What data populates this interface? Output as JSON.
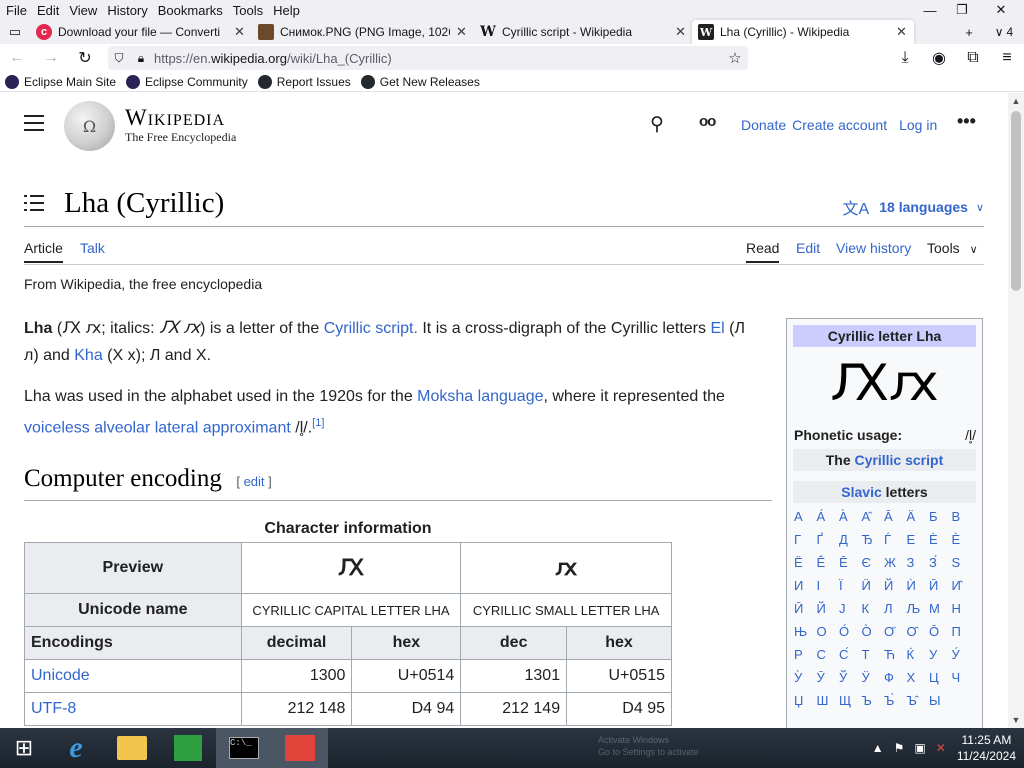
{
  "menubar": {
    "items": [
      "File",
      "Edit",
      "View",
      "History",
      "Bookmarks",
      "Tools",
      "Help"
    ]
  },
  "tabs": [
    {
      "title": "Download your file — Converti",
      "icon": "converter-icon"
    },
    {
      "title": "Снимок.PNG (PNG Image, 1026",
      "icon": "image-icon"
    },
    {
      "title": "Cyrillic script - Wikipedia",
      "icon": "wikipedia-icon"
    },
    {
      "title": "Lha (Cyrillic) - Wikipedia",
      "icon": "wikipedia-icon",
      "active": true
    }
  ],
  "tab_count": "4",
  "url": {
    "prefix": "https://en.",
    "domain": "wikipedia.org",
    "path": "/wiki/Lha_(Cyrillic)"
  },
  "bookmarks": [
    "Eclipse Main Site",
    "Eclipse Community",
    "Report Issues",
    "Get New Releases"
  ],
  "wiki": {
    "wordmark": "Wikipedia",
    "tagline_logo": "The Free Encyclopedia",
    "header_links": [
      "Donate",
      "Create account",
      "Log in"
    ],
    "title": "Lha (Cyrillic)",
    "languages": "18 languages",
    "tabs_left": [
      "Article",
      "Talk"
    ],
    "tabs_right": [
      "Read",
      "Edit",
      "View history",
      "Tools"
    ],
    "from": "From Wikipedia, the free encyclopedia",
    "p1": {
      "bold": "Lha",
      "t1": " (Ԕ ԕ; italics: ",
      "italic": "Ԕ ԕ",
      "t2": ") is a letter of the ",
      "link1": "Cyrillic script.",
      "t3": " It is a cross-digraph of the Cyrillic letters ",
      "link2": "El",
      "t4": " (Л л) and ",
      "link3": "Kha",
      "t5": " (Х х); Л and Х."
    },
    "p2": {
      "t1": "Lha was used in the alphabet used in the 1920s for the ",
      "link1": "Moksha language",
      "t2": ", where it represented the ",
      "link2": "voiceless alveolar lateral approximant",
      "t3": " /l̥/.",
      "ref": "[1]"
    },
    "section": {
      "title": "Computer encoding",
      "edit": "edit"
    },
    "table": {
      "caption": "Character information",
      "preview_label": "Preview",
      "preview_upper": "Ԕ",
      "preview_lower": "ԕ",
      "unicode_name_label": "Unicode name",
      "name_upper": "CYRILLIC CAPITAL LETTER LHA",
      "name_lower": "CYRILLIC SMALL LETTER LHA",
      "encodings_label": "Encodings",
      "col_decimal": "decimal",
      "col_hex": "hex",
      "col_dec": "dec",
      "col_hex2": "hex",
      "rows": [
        {
          "enc": "Unicode",
          "dec1": "1300",
          "hex1": "U+0514",
          "dec2": "1301",
          "hex2": "U+0515"
        },
        {
          "enc": "UTF-8",
          "dec1": "212 148",
          "hex1": "D4 94",
          "dec2": "212 149",
          "hex2": "D4 95"
        }
      ]
    },
    "infobox": {
      "title": "Cyrillic letter Lha",
      "glyph": "Ԕԕ",
      "phonetic_label": "Phonetic usage:",
      "phonetic_value": "/l̥/",
      "script_pre": "The ",
      "script_link": "Cyrillic script",
      "slavic_link": "Slavic",
      "slavic_post": " letters",
      "letters": [
        "А",
        "А́",
        "А̀",
        "А̂",
        "А̄",
        "Ӓ",
        "Б",
        "В",
        "Г",
        "Ґ",
        "Д",
        "Ђ",
        "Ѓ",
        "Е",
        "Ѐ",
        "Ѐ",
        "Ё",
        "Ê",
        "Ē",
        "Є",
        "Ж",
        "З",
        "З́",
        "Ѕ",
        "И",
        "І",
        "Ї",
        "Ӥ",
        "Й",
        "Ѝ",
        "Ӣ",
        "И̂",
        "Ӣ",
        "Й",
        "Ј",
        "К",
        "Л",
        "Љ",
        "М",
        "Н",
        "Њ",
        "О",
        "О́",
        "О̀",
        "О̆",
        "О̂",
        "Ō",
        "П",
        "Р",
        "С",
        "С́",
        "Т",
        "Ћ",
        "Ќ",
        "У",
        "У́",
        "У̀",
        "Ӯ",
        "Ў",
        "Ӱ",
        "Ф",
        "Х",
        "Ц",
        "Ч",
        "Џ",
        "Ш",
        "Щ",
        "Ъ",
        "Ъ̀",
        "Ъ̂",
        "Ы"
      ]
    }
  },
  "taskbar": {
    "time": "11:25 AM",
    "date": "11/24/2024",
    "watermark_1": "Activate Windows",
    "watermark_2": "Go to Settings to activate"
  }
}
